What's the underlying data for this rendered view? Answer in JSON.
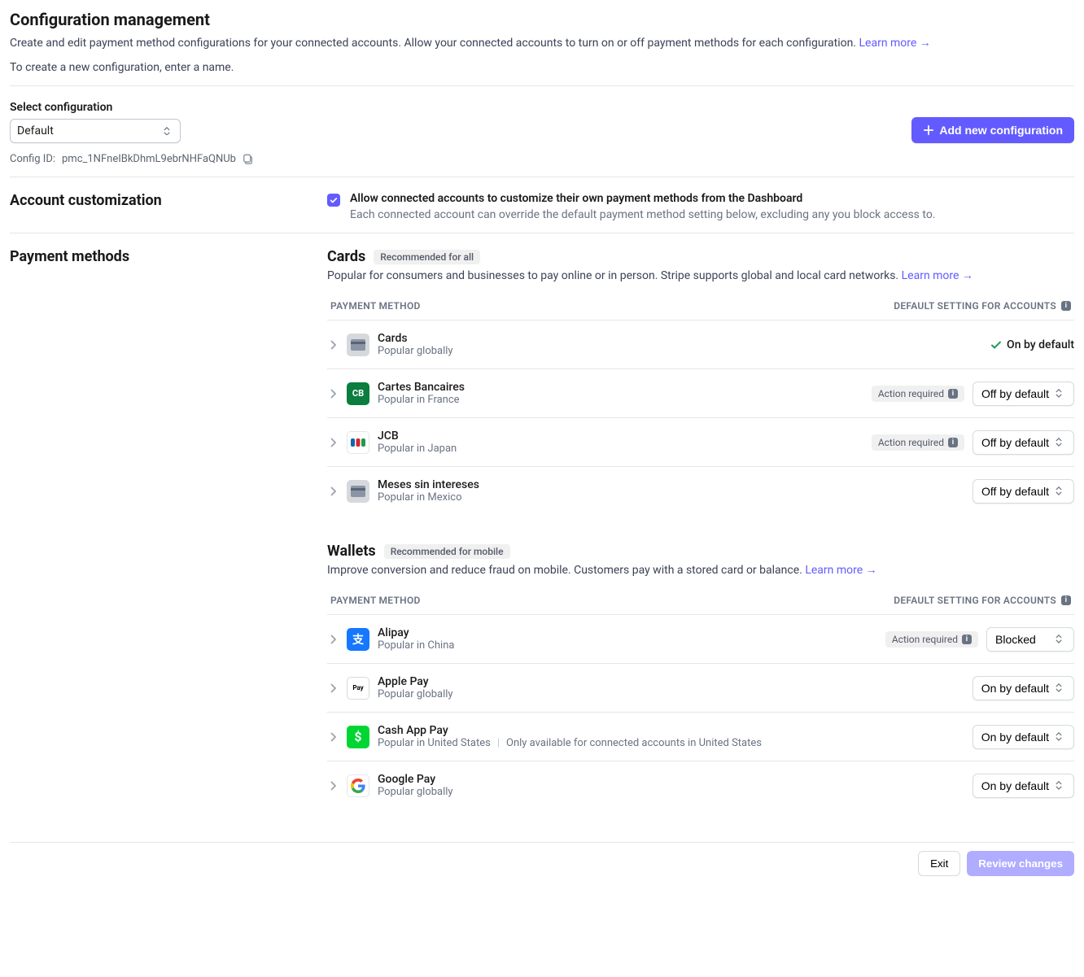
{
  "header": {
    "title": "Configuration management",
    "subtitle": "Create and edit payment method configurations for your connected accounts. Allow your connected accounts to turn on or off payment methods for each configuration.",
    "learn_more": "Learn more",
    "note": "To create a new configuration, enter a name."
  },
  "config": {
    "label": "Select configuration",
    "selected": "Default",
    "add_btn": "Add new configuration",
    "id_label": "Config ID:",
    "id_value": "pmc_1NFneIBkDhmL9ebrNHFaQNUb"
  },
  "customization": {
    "heading": "Account customization",
    "title": "Allow connected accounts to customize their own payment methods from the Dashboard",
    "sub": "Each connected account can override the default payment method setting below, excluding any you block access to."
  },
  "pm": {
    "heading": "Payment methods",
    "col_left": "PAYMENT METHOD",
    "col_right": "DEFAULT SETTING FOR ACCOUNTS",
    "action_required": "Action required",
    "on_default_static": "On by default",
    "states": {
      "off": "Off by default",
      "on": "On by default",
      "blocked": "Blocked"
    },
    "groups": {
      "cards": {
        "title": "Cards",
        "badge": "Recommended for all",
        "desc": "Popular for consumers and businesses to pay online or in person. Stripe supports global and local card networks.",
        "learn_more": "Learn more",
        "items": {
          "cards": {
            "name": "Cards",
            "sub": "Popular globally"
          },
          "cb": {
            "name": "Cartes Bancaires",
            "sub": "Popular in France"
          },
          "jcb": {
            "name": "JCB",
            "sub": "Popular in Japan"
          },
          "msi": {
            "name": "Meses sin intereses",
            "sub": "Popular in Mexico"
          }
        }
      },
      "wallets": {
        "title": "Wallets",
        "badge": "Recommended for mobile",
        "desc": "Improve conversion and reduce fraud on mobile. Customers pay with a stored card or balance.",
        "learn_more": "Learn more",
        "items": {
          "alipay": {
            "name": "Alipay",
            "sub": "Popular in China"
          },
          "applepay": {
            "name": "Apple Pay",
            "sub": "Popular globally"
          },
          "cashapp": {
            "name": "Cash App Pay",
            "sub": "Popular in United States",
            "extra": "Only available for connected accounts in United States"
          },
          "googlepay": {
            "name": "Google Pay",
            "sub": "Popular globally"
          }
        }
      }
    }
  },
  "footer": {
    "exit": "Exit",
    "review": "Review changes"
  }
}
